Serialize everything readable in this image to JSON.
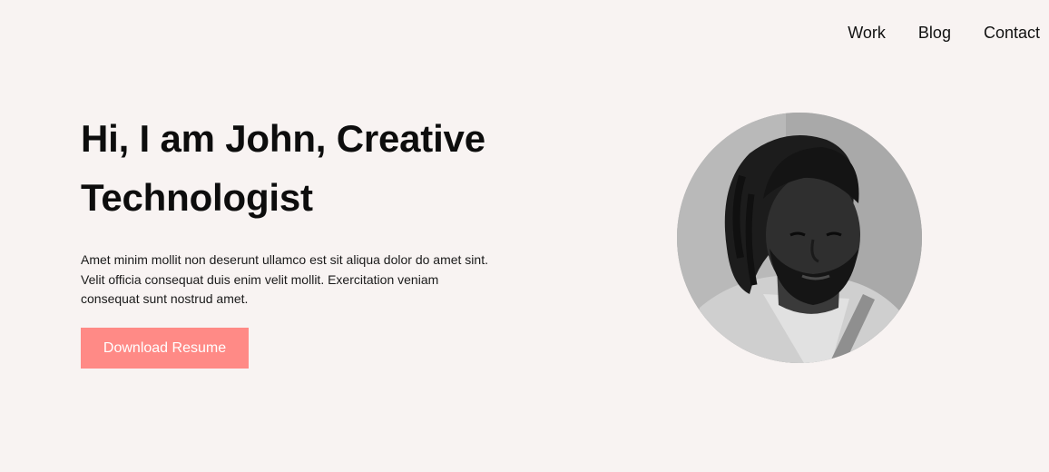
{
  "nav": {
    "items": [
      {
        "label": "Work"
      },
      {
        "label": "Blog"
      },
      {
        "label": "Contact"
      }
    ]
  },
  "hero": {
    "title": "Hi, I am John, Creative Technologist",
    "description": "Amet minim mollit non deserunt ullamco est sit aliqua dolor do amet sint. Velit officia consequat duis enim velit mollit. Exercitation veniam consequat sunt nostrud amet.",
    "cta_label": "Download Resume"
  },
  "colors": {
    "background": "#f8f3f2",
    "accent": "#ff8a86",
    "text": "#111111"
  }
}
